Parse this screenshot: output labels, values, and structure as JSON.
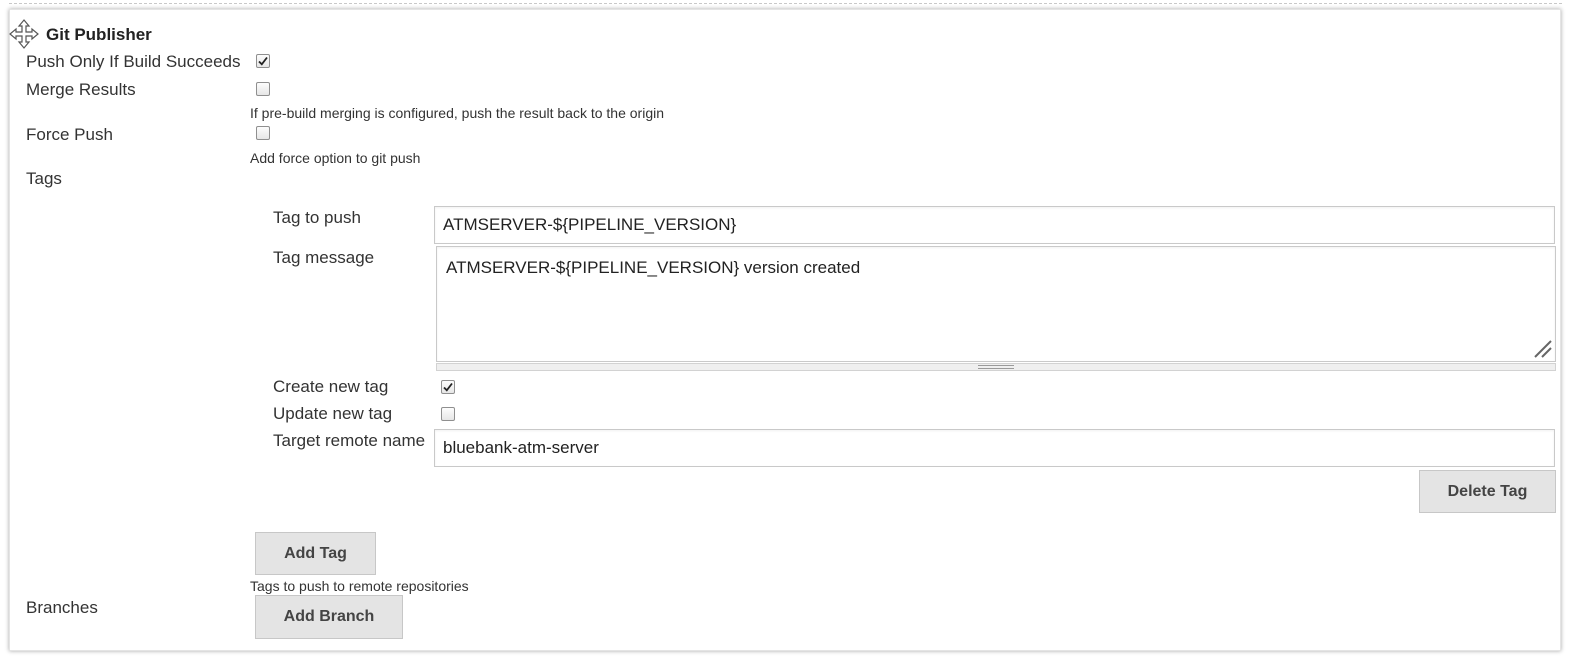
{
  "section": {
    "title": "Git Publisher",
    "drag_icon": "move-arrows-icon"
  },
  "options": {
    "push_only_label": "Push Only If Build Succeeds",
    "push_only_checked": true,
    "merge_label": "Merge Results",
    "merge_checked": false,
    "merge_help": "If pre-build merging is configured, push the result back to the origin",
    "force_label": "Force Push",
    "force_checked": false,
    "force_help": "Add force option to git push"
  },
  "tags": {
    "label": "Tags",
    "tag_to_push_label": "Tag to push",
    "tag_to_push_value": "ATMSERVER-${PIPELINE_VERSION}",
    "tag_message_label": "Tag message",
    "tag_message_value": "ATMSERVER-${PIPELINE_VERSION} version created",
    "create_label": "Create new tag",
    "create_checked": true,
    "update_label": "Update new tag",
    "update_checked": false,
    "target_label": "Target remote name",
    "target_value": "bluebank-atm-server",
    "delete_button": "Delete Tag",
    "add_button": "Add Tag",
    "help": "Tags to push to remote repositories"
  },
  "branches": {
    "label": "Branches",
    "add_button": "Add Branch"
  },
  "colors": {
    "button_bg": "#e4e4e4",
    "border": "#c9c9c9",
    "text": "#333333"
  }
}
